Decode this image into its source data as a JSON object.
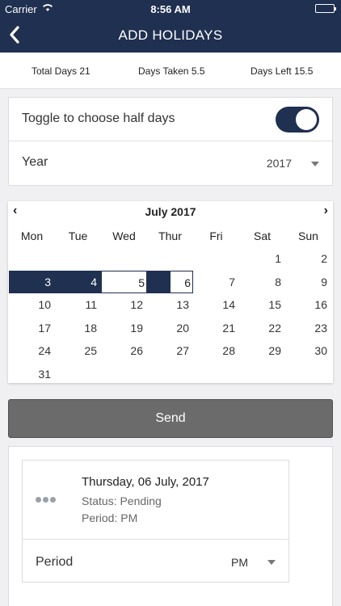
{
  "status_bar": {
    "carrier": "Carrier",
    "time": "8:56 AM"
  },
  "nav": {
    "title": "ADD HOLIDAYS",
    "back_icon": "chevron-left-icon"
  },
  "stats": {
    "total": "Total Days 21",
    "taken": "Days Taken 5.5",
    "left": "Days Left 15.5"
  },
  "settings": {
    "half_days_label": "Toggle to choose half days",
    "half_days_on": true,
    "year_label": "Year",
    "year_value": "2017"
  },
  "calendar": {
    "month_label": "July 2017",
    "prev": "‹",
    "next": "›",
    "weekdays": [
      "Mon",
      "Tue",
      "Wed",
      "Thur",
      "Fri",
      "Sat",
      "Sun"
    ],
    "first_day_col": 5,
    "days_in_month": 31,
    "selected_full": [
      3,
      4
    ],
    "selected_half": [
      5,
      6
    ],
    "selection_color": "#1f3050"
  },
  "send_label": "Send",
  "request": {
    "dots_icon": "more-dots-icon",
    "date": "Thursday, 06 July, 2017",
    "status": "Status: Pending",
    "period": "Period: PM",
    "period_label": "Period",
    "period_value": "PM"
  },
  "colors": {
    "brand": "#1f3050",
    "button": "#6b6b6b"
  }
}
